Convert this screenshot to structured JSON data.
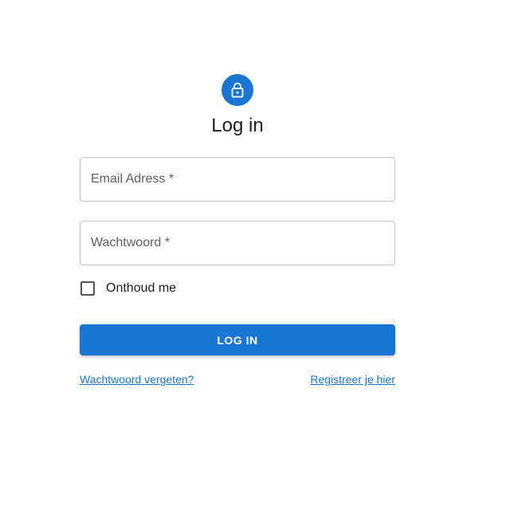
{
  "header": {
    "icon": "lock-icon",
    "title": "Log in"
  },
  "form": {
    "email_label": "Email Adress *",
    "email_value": "",
    "password_label": "Wachtwoord *",
    "password_value": "",
    "remember_label": "Onthoud me",
    "remember_checked": false,
    "submit_label": "LOG IN"
  },
  "links": {
    "forgot_password": "Wachtwoord vergeten?",
    "register": "Registreer je hier"
  },
  "colors": {
    "primary": "#1976d2",
    "border": "#c4c4c4",
    "text": "#1f1f1f"
  }
}
